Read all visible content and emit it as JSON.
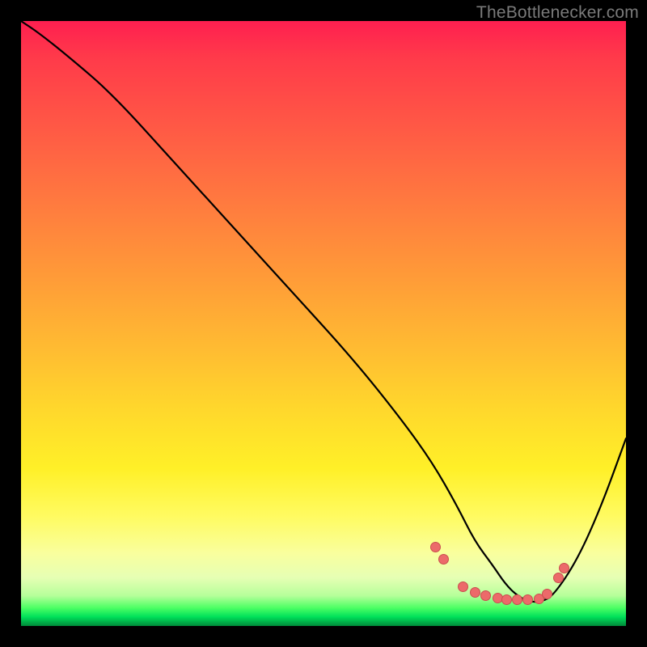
{
  "watermark": "TheBottlenecker.com",
  "chart_data": {
    "type": "line",
    "title": "",
    "xlabel": "",
    "ylabel": "",
    "xlim": [
      0,
      100
    ],
    "ylim": [
      0,
      100
    ],
    "series": [
      {
        "name": "bottleneck-curve",
        "x": [
          0,
          3,
          8,
          15,
          25,
          35,
          45,
          55,
          63,
          68,
          72,
          75,
          78,
          80,
          82,
          84,
          86,
          88,
          92,
          96,
          100
        ],
        "y": [
          100,
          98,
          94,
          88,
          77,
          66,
          55,
          44,
          34,
          27,
          20,
          14,
          10,
          7,
          5,
          4,
          4,
          5,
          11,
          20,
          31
        ]
      }
    ],
    "markers": {
      "name": "highlight-dots",
      "points": [
        {
          "x": 68.5,
          "y": 13.0
        },
        {
          "x": 69.8,
          "y": 11.0
        },
        {
          "x": 73.0,
          "y": 6.5
        },
        {
          "x": 75.0,
          "y": 5.5
        },
        {
          "x": 76.8,
          "y": 5.0
        },
        {
          "x": 78.8,
          "y": 4.6
        },
        {
          "x": 80.3,
          "y": 4.4
        },
        {
          "x": 82.0,
          "y": 4.3
        },
        {
          "x": 83.8,
          "y": 4.3
        },
        {
          "x": 85.6,
          "y": 4.5
        },
        {
          "x": 87.0,
          "y": 5.3
        },
        {
          "x": 88.8,
          "y": 8.0
        },
        {
          "x": 89.8,
          "y": 9.5
        }
      ]
    },
    "background": {
      "type": "vertical-gradient",
      "stops": [
        {
          "pos": 0.0,
          "color": "#ff1f50"
        },
        {
          "pos": 0.5,
          "color": "#ffbb32"
        },
        {
          "pos": 0.82,
          "color": "#fffb62"
        },
        {
          "pos": 0.97,
          "color": "#4cff64"
        },
        {
          "pos": 1.0,
          "color": "#008a3a"
        }
      ]
    }
  }
}
